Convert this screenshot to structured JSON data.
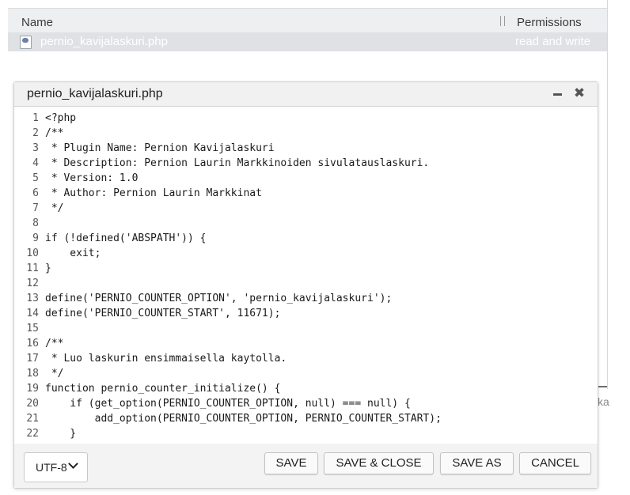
{
  "file_list": {
    "columns": {
      "name": "Name",
      "permissions": "Permissions"
    },
    "row": {
      "name": "pernio_kavijalaskuri.php",
      "permissions": "read and write",
      "icon": "php-file-icon"
    },
    "clipped_text": "ka"
  },
  "dialog": {
    "title": "pernio_kavijalaskuri.php",
    "minimize_icon": "minimize-icon",
    "close_icon": "close-icon",
    "code_lines": [
      {
        "n": "1",
        "t": "<?php"
      },
      {
        "n": "2",
        "t": "/**"
      },
      {
        "n": "3",
        "t": " * Plugin Name: Pernion Kavijalaskuri"
      },
      {
        "n": "4",
        "t": " * Description: Pernion Laurin Markkinoiden sivulatauslaskuri."
      },
      {
        "n": "5",
        "t": " * Version: 1.0"
      },
      {
        "n": "6",
        "t": " * Author: Pernion Laurin Markkinat"
      },
      {
        "n": "7",
        "t": " */"
      },
      {
        "n": "8",
        "t": ""
      },
      {
        "n": "9",
        "t": "if (!defined('ABSPATH')) {"
      },
      {
        "n": "10",
        "t": "    exit;"
      },
      {
        "n": "11",
        "t": "}"
      },
      {
        "n": "12",
        "t": ""
      },
      {
        "n": "13",
        "t": "define('PERNIO_COUNTER_OPTION', 'pernio_kavijalaskuri');"
      },
      {
        "n": "14",
        "t": "define('PERNIO_COUNTER_START', 11671);"
      },
      {
        "n": "15",
        "t": ""
      },
      {
        "n": "16",
        "t": "/**"
      },
      {
        "n": "17",
        "t": " * Luo laskurin ensimmaisella kaytolla."
      },
      {
        "n": "18",
        "t": " */"
      },
      {
        "n": "19",
        "t": "function pernio_counter_initialize() {"
      },
      {
        "n": "20",
        "t": "    if (get_option(PERNIO_COUNTER_OPTION, null) === null) {"
      },
      {
        "n": "21",
        "t": "        add_option(PERNIO_COUNTER_OPTION, PERNIO_COUNTER_START);"
      },
      {
        "n": "22",
        "t": "    }"
      }
    ],
    "encoding": "UTF-8",
    "buttons": {
      "save": "SAVE",
      "save_close": "SAVE & CLOSE",
      "save_as": "SAVE AS",
      "cancel": "CANCEL"
    }
  }
}
